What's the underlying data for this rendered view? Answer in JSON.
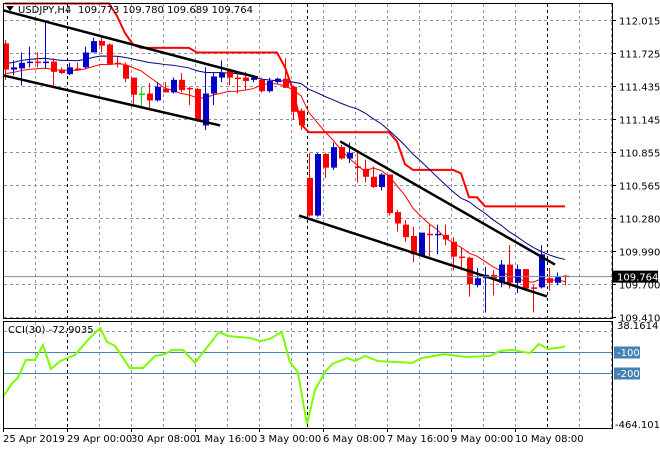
{
  "header": {
    "symbol_timeframe": "USDJPY,H4",
    "ohlc": "109.773 109.780 109.689 109.764"
  },
  "colors": {
    "bull": "#0000c8",
    "bear": "#ff0000",
    "doji": "#00e000",
    "fast_ma": "#ff0000",
    "slow_ma": "#000080",
    "step_line": "#ff0000",
    "trendline": "#000000",
    "cci": "#7cfc00",
    "cci_levels": "#4682b4",
    "grid": "#8a96a3",
    "current_price_bg": "#000000"
  },
  "chart_data": [
    {
      "type": "candlestick",
      "symbol": "USDJPY",
      "timeframe": "H4",
      "y_ticks": [
        "112.015",
        "111.725",
        "111.435",
        "111.145",
        "110.855",
        "110.565",
        "110.280",
        "109.990",
        "109.700",
        "109.410"
      ],
      "ylim": [
        109.41,
        112.17
      ],
      "x_tick_labels": [
        {
          "bar": 0,
          "label": "25 Apr 2019"
        },
        {
          "bar": 8,
          "label": "29 Apr 00:00"
        },
        {
          "bar": 16,
          "label": "30 Apr 08:00"
        },
        {
          "bar": 24,
          "label": "1 May 16:00"
        },
        {
          "bar": 32,
          "label": "3 May 00:00"
        },
        {
          "bar": 40,
          "label": "6 May 08:00"
        },
        {
          "bar": 48,
          "label": "7 May 16:00"
        },
        {
          "bar": 56,
          "label": "9 May 00:00"
        },
        {
          "bar": 64,
          "label": "10 May 08:00"
        }
      ],
      "period_separators_at_bar": [
        7.75,
        37.75,
        67.75
      ],
      "current_price": "109.764",
      "grid": true,
      "ohlc": [
        [
          111.81,
          111.84,
          111.49,
          111.58
        ],
        [
          111.58,
          111.66,
          111.53,
          111.6
        ],
        [
          111.59,
          111.73,
          111.44,
          111.64
        ],
        [
          111.64,
          111.78,
          111.6,
          111.65
        ],
        [
          111.65,
          111.73,
          111.6,
          111.64
        ],
        [
          111.64,
          112.01,
          111.59,
          111.65
        ],
        [
          111.65,
          111.68,
          111.44,
          111.56
        ],
        [
          111.58,
          111.6,
          111.54,
          111.55
        ],
        [
          111.54,
          111.64,
          111.53,
          111.6
        ],
        [
          111.59,
          111.64,
          111.58,
          111.58
        ],
        [
          111.6,
          111.78,
          111.59,
          111.73
        ],
        [
          111.73,
          111.86,
          111.73,
          111.83
        ],
        [
          111.83,
          111.86,
          111.73,
          111.79
        ],
        [
          111.8,
          111.81,
          111.62,
          111.63
        ],
        [
          111.64,
          111.69,
          111.6,
          111.63
        ],
        [
          111.62,
          111.64,
          111.47,
          111.5
        ],
        [
          111.51,
          111.51,
          111.27,
          111.36
        ],
        [
          111.37,
          111.43,
          111.24,
          111.37
        ],
        [
          111.37,
          111.46,
          111.23,
          111.31
        ],
        [
          111.31,
          111.47,
          111.3,
          111.43
        ],
        [
          111.41,
          111.47,
          111.38,
          111.38
        ],
        [
          111.38,
          111.51,
          111.37,
          111.49
        ],
        [
          111.49,
          111.55,
          111.38,
          111.4
        ],
        [
          111.42,
          111.43,
          111.27,
          111.41
        ],
        [
          111.41,
          111.42,
          111.12,
          111.14
        ],
        [
          111.09,
          111.6,
          111.05,
          111.37
        ],
        [
          111.37,
          111.55,
          111.27,
          111.52
        ],
        [
          111.51,
          111.66,
          111.47,
          111.55
        ],
        [
          111.58,
          111.59,
          111.44,
          111.51
        ],
        [
          111.51,
          111.56,
          111.37,
          111.5
        ],
        [
          111.51,
          111.56,
          111.4,
          111.48
        ],
        [
          111.49,
          111.53,
          111.47,
          111.51
        ],
        [
          111.49,
          111.51,
          111.38,
          111.39
        ],
        [
          111.39,
          111.51,
          111.38,
          111.48
        ],
        [
          111.47,
          111.51,
          111.46,
          111.5
        ],
        [
          111.5,
          111.68,
          111.42,
          111.42
        ],
        [
          111.43,
          111.44,
          111.14,
          111.21
        ],
        [
          111.22,
          111.24,
          111.05,
          111.09
        ],
        [
          110.63,
          110.85,
          110.29,
          110.3
        ],
        [
          110.3,
          110.85,
          110.29,
          110.84
        ],
        [
          110.84,
          110.85,
          110.63,
          110.72
        ],
        [
          110.72,
          110.94,
          110.7,
          110.9
        ],
        [
          110.9,
          110.92,
          110.79,
          110.8
        ],
        [
          110.8,
          110.94,
          110.76,
          110.85
        ],
        [
          110.73,
          110.85,
          110.59,
          110.72
        ],
        [
          110.71,
          110.79,
          110.59,
          110.64
        ],
        [
          110.64,
          110.73,
          110.54,
          110.55
        ],
        [
          110.55,
          110.67,
          110.52,
          110.66
        ],
        [
          110.66,
          110.66,
          110.3,
          110.32
        ],
        [
          110.33,
          110.35,
          110.16,
          110.23
        ],
        [
          110.22,
          110.26,
          110.07,
          110.11
        ],
        [
          110.12,
          110.2,
          109.89,
          109.96
        ],
        [
          109.95,
          110.15,
          109.94,
          110.15
        ],
        [
          110.14,
          110.22,
          109.94,
          110.13
        ],
        [
          110.13,
          110.22,
          109.96,
          110.14
        ],
        [
          110.13,
          110.22,
          110.04,
          110.09
        ],
        [
          110.07,
          110.11,
          109.82,
          109.94
        ],
        [
          109.94,
          110.02,
          109.82,
          109.93
        ],
        [
          109.93,
          109.94,
          109.59,
          109.7
        ],
        [
          109.69,
          109.84,
          109.67,
          109.75
        ],
        [
          109.75,
          109.85,
          109.45,
          109.78
        ],
        [
          109.78,
          109.82,
          109.6,
          109.75
        ],
        [
          109.71,
          109.91,
          109.67,
          109.87
        ],
        [
          109.87,
          110.04,
          109.66,
          109.71
        ],
        [
          109.71,
          109.87,
          109.62,
          109.83
        ],
        [
          109.83,
          109.83,
          109.66,
          109.66
        ],
        [
          109.67,
          109.69,
          109.45,
          109.66
        ],
        [
          109.67,
          110.04,
          109.66,
          109.96
        ],
        [
          109.75,
          109.84,
          109.64,
          109.71
        ],
        [
          109.71,
          109.8,
          109.69,
          109.76
        ],
        [
          109.773,
          109.78,
          109.689,
          109.764
        ]
      ],
      "step_line": [
        112.16,
        112.16,
        112.16,
        112.16,
        112.16,
        112.16,
        112.16,
        112.16,
        112.16,
        112.16,
        112.16,
        112.16,
        112.16,
        112.16,
        112.05,
        111.9,
        111.8,
        111.77,
        111.77,
        111.77,
        111.77,
        111.77,
        111.77,
        111.77,
        111.73,
        111.73,
        111.73,
        111.73,
        111.73,
        111.73,
        111.73,
        111.73,
        111.73,
        111.73,
        111.73,
        111.6,
        111.4,
        111.1,
        111.03,
        111.03,
        111.03,
        111.03,
        111.03,
        111.03,
        111.03,
        111.03,
        111.03,
        111.03,
        111.03,
        110.95,
        110.75,
        110.7,
        110.7,
        110.7,
        110.7,
        110.7,
        110.7,
        110.67,
        110.46,
        110.46,
        110.38,
        110.38,
        110.38,
        110.38,
        110.38,
        110.38,
        110.38,
        110.38,
        110.38,
        110.38,
        110.38
      ],
      "trendlines": [
        {
          "from": [
            -0.25,
            112.1
          ],
          "to": [
            31.6,
            111.51
          ]
        },
        {
          "from": [
            -0.25,
            111.53
          ],
          "to": [
            26.9,
            111.09
          ]
        },
        {
          "from": [
            41.9,
            110.95
          ],
          "to": [
            68.75,
            109.87
          ]
        },
        {
          "from": [
            36.75,
            110.3
          ],
          "to": [
            67.75,
            109.59
          ]
        }
      ]
    },
    {
      "type": "line",
      "title": "CCI(30) -72.9035",
      "y_ticks": [
        "38.1614",
        "-100",
        "-200",
        "-464.1012"
      ],
      "ylim": [
        -464.1012,
        38.1614
      ],
      "levels": [
        -100,
        -200
      ],
      "points": [
        [
          -0.25,
          -314
        ],
        [
          0.9,
          -248
        ],
        [
          1.6,
          -224
        ],
        [
          2.6,
          -138
        ],
        [
          3.75,
          -138
        ],
        [
          4.75,
          -67
        ],
        [
          5.75,
          -181
        ],
        [
          6.9,
          -143
        ],
        [
          8.75,
          -114
        ],
        [
          10.6,
          -33
        ],
        [
          11.9,
          14
        ],
        [
          12.75,
          -52
        ],
        [
          13.75,
          -71
        ],
        [
          15.6,
          -176
        ],
        [
          17.25,
          -176
        ],
        [
          18.75,
          -119
        ],
        [
          20,
          -110
        ],
        [
          20.9,
          -90
        ],
        [
          22.25,
          -90
        ],
        [
          23.75,
          -152
        ],
        [
          25,
          -90
        ],
        [
          26.75,
          -5
        ],
        [
          27.9,
          -24
        ],
        [
          29.4,
          -29
        ],
        [
          30.6,
          -33
        ],
        [
          31.9,
          -48
        ],
        [
          33.1,
          -38
        ],
        [
          34.6,
          -5
        ],
        [
          35.6,
          -148
        ],
        [
          36.6,
          -195
        ],
        [
          37.75,
          -443
        ],
        [
          38.75,
          -281
        ],
        [
          40,
          -195
        ],
        [
          40.9,
          -157
        ],
        [
          42.75,
          -129
        ],
        [
          43.75,
          -143
        ],
        [
          45,
          -119
        ],
        [
          46.6,
          -143
        ],
        [
          50.9,
          -152
        ],
        [
          52.1,
          -129
        ],
        [
          54.9,
          -110
        ],
        [
          57.6,
          -124
        ],
        [
          60.6,
          -119
        ],
        [
          61.9,
          -95
        ],
        [
          63.4,
          -90
        ],
        [
          65.6,
          -105
        ],
        [
          66.75,
          -62
        ],
        [
          67.9,
          -86
        ],
        [
          69.75,
          -76
        ],
        [
          70,
          -72.9
        ]
      ]
    }
  ]
}
